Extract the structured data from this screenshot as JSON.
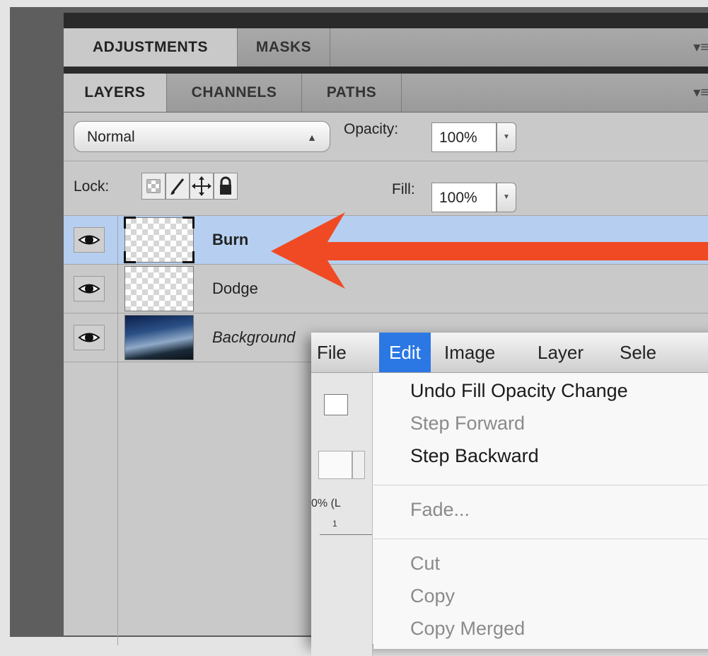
{
  "top_tabs": [
    "ADJUSTMENTS",
    "MASKS"
  ],
  "layer_tabs": [
    "LAYERS",
    "CHANNELS",
    "PATHS"
  ],
  "panel_menu_icon": "▾≡",
  "blend_mode": "Normal",
  "opacity_label": "Opacity:",
  "opacity_value": "100%",
  "lock_label": "Lock:",
  "fill_label": "Fill:",
  "fill_value": "100%",
  "layers": [
    {
      "name": "Burn",
      "selected": true
    },
    {
      "name": "Dodge",
      "selected": false
    },
    {
      "name": "Background",
      "selected": false
    }
  ],
  "menubar": [
    "File",
    "Edit",
    "Image",
    "Layer",
    "Sele"
  ],
  "behind_text": "0% (L",
  "ruler_tick": "1",
  "edit_menu": [
    {
      "label": "Undo Fill Opacity Change",
      "enabled": true
    },
    {
      "label": "Step Forward",
      "enabled": false
    },
    {
      "label": "Step Backward",
      "enabled": true
    },
    {
      "label": "Fade...",
      "enabled": false
    },
    {
      "label": "Cut",
      "enabled": false
    },
    {
      "label": "Copy",
      "enabled": false
    },
    {
      "label": "Copy Merged",
      "enabled": false
    }
  ],
  "arrow_color": "#f04a24",
  "selection_color": "#b6cff0",
  "menu_highlight": "#2b78e4"
}
